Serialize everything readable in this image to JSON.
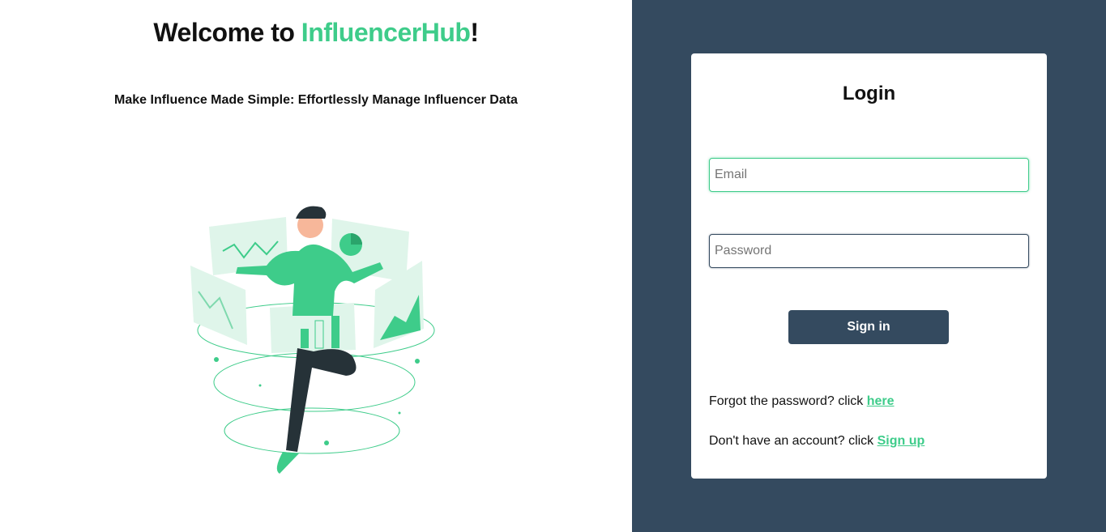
{
  "left": {
    "welcome_prefix": "Welcome to ",
    "brand_name": "InfluencerHub",
    "welcome_suffix": "!",
    "tagline": "Make Influence Made Simple: Effortlessly Manage Influencer Data",
    "illustration": "person-with-dashboards-illustration"
  },
  "login": {
    "title": "Login",
    "email_placeholder": "Email",
    "email_value": "",
    "password_placeholder": "Password",
    "password_value": "",
    "signin_label": "Sign in",
    "forgot_text": "Forgot the password? click ",
    "forgot_link": "here",
    "signup_text": "Don't have an account? click ",
    "signup_link": "Sign up"
  },
  "colors": {
    "brand_green": "#3ecc8a",
    "panel_navy": "#344a5f"
  }
}
